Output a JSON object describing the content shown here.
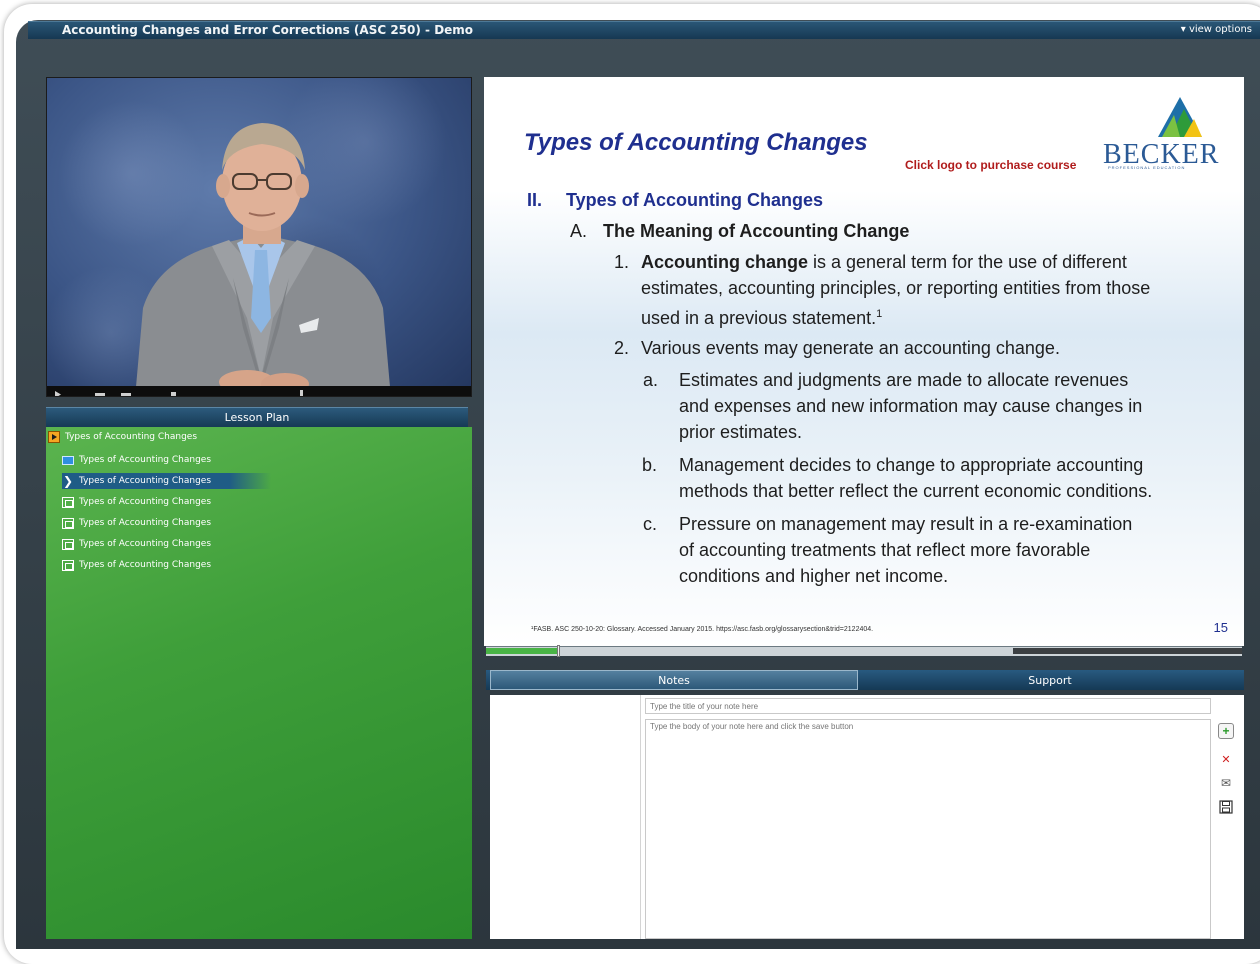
{
  "window": {
    "title": "Accounting Changes and Error Corrections (ASC 250) - Demo",
    "view_options": "▾ view options"
  },
  "lesson_plan": {
    "header": "Lesson Plan",
    "items": [
      {
        "label": "Types of Accounting Changes",
        "icon": "folder-play-icon"
      },
      {
        "label": "Types of Accounting Changes",
        "icon": "video-icon"
      },
      {
        "label": "Types of Accounting Changes",
        "icon": "current-arrow-icon",
        "selected": true
      },
      {
        "label": "Types of Accounting Changes",
        "icon": "page-icon"
      },
      {
        "label": "Types of Accounting Changes",
        "icon": "page-icon"
      },
      {
        "label": "Types of Accounting Changes",
        "icon": "page-icon"
      },
      {
        "label": "Types of Accounting Changes",
        "icon": "page-icon"
      }
    ]
  },
  "slide": {
    "heading": "Types of Accounting Changes",
    "purchase_text": "Click logo to purchase course",
    "logo_text": "BECKER",
    "logo_subtext": "PROFESSIONAL EDUCATION",
    "section_num": "II.",
    "section_title": "Types of Accounting Changes",
    "sub_a_letter": "A.",
    "sub_a_title": "The Meaning of Accounting Change",
    "p1_num": "1.",
    "p1_bold": "Accounting change",
    "p1_rest_1": " is a general term for the use of different",
    "p1_line2": "estimates, accounting principles, or reporting entities from those",
    "p1_line3": "used in a previous statement.",
    "p1_sup": "1",
    "p2_num": "2.",
    "p2_text": "Various events may generate an accounting change.",
    "a_letter": "a.",
    "a_line1": "Estimates and judgments are made to allocate revenues",
    "a_line2": "and expenses and new information may cause changes in",
    "a_line3": "prior estimates.",
    "b_letter": "b.",
    "b_line1": "Management decides to change to appropriate accounting",
    "b_line2": "methods that better reflect the current economic conditions.",
    "c_letter": "c.",
    "c_line1": "Pressure on management may result in a re-examination",
    "c_line2": "of accounting treatments that reflect more favorable",
    "c_line3": "conditions and higher net income.",
    "footnote": "¹FASB. ASC 250-10-20: Glossary. Accessed January 2015. https://asc.fasb.org/glossarysection&trid=2122404.",
    "page_number": "15"
  },
  "progress": {
    "played_fraction": 0.094,
    "buffered_end_fraction": 0.697
  },
  "notes_panel": {
    "tabs": [
      "Notes",
      "Support"
    ],
    "active_tab": "Notes",
    "title_placeholder": "Type the title of your note here",
    "body_placeholder": "Type the body of your note here and click the save button"
  },
  "colors": {
    "heading": "#1f2f8f",
    "purchase": "#b01c1c",
    "lesson_panel": "#3f9f3a",
    "title_bar": "#163852"
  }
}
